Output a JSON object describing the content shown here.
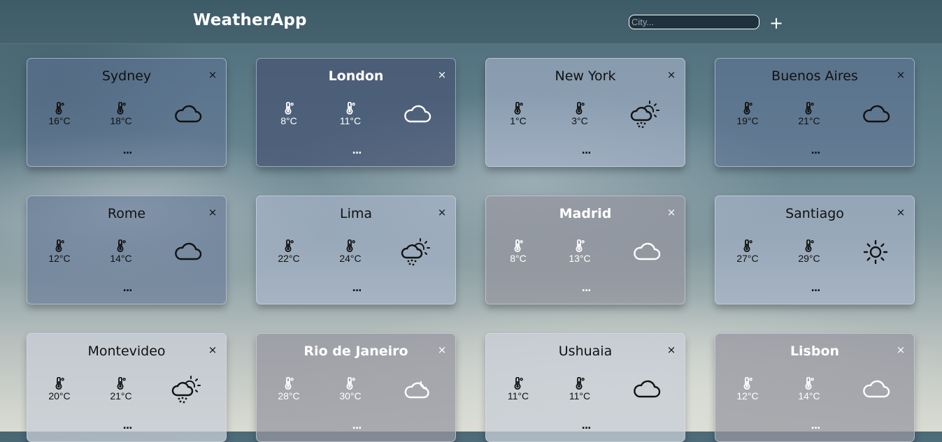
{
  "app": {
    "brand": "WeatherApp",
    "search_placeholder": "City...",
    "add_label": "+"
  },
  "cards": [
    {
      "city": "Sydney",
      "min": "16°C",
      "max": "18°C",
      "icon": "cloud-icon",
      "style": "normal",
      "close": "×",
      "more": "..."
    },
    {
      "city": "London",
      "min": "8°C",
      "max": "11°C",
      "icon": "cloud-icon",
      "style": "dark",
      "close": "×",
      "more": "..."
    },
    {
      "city": "New York",
      "min": "1°C",
      "max": "3°C",
      "icon": "sun-cloud-rain-icon",
      "style": "light",
      "close": "×",
      "more": "..."
    },
    {
      "city": "Buenos Aires",
      "min": "19°C",
      "max": "21°C",
      "icon": "cloud-icon",
      "style": "normal",
      "close": "×",
      "more": "..."
    },
    {
      "city": "Rome",
      "min": "12°C",
      "max": "14°C",
      "icon": "cloud-icon",
      "style": "normal",
      "close": "×",
      "more": "..."
    },
    {
      "city": "Lima",
      "min": "22°C",
      "max": "24°C",
      "icon": "sun-cloud-rain-icon",
      "style": "light",
      "close": "×",
      "more": "..."
    },
    {
      "city": "Madrid",
      "min": "8°C",
      "max": "13°C",
      "icon": "cloud-icon",
      "style": "gray",
      "close": "×",
      "more": "..."
    },
    {
      "city": "Santiago",
      "min": "27°C",
      "max": "29°C",
      "icon": "sun-icon",
      "style": "light",
      "close": "×",
      "more": "..."
    },
    {
      "city": "Montevideo",
      "min": "20°C",
      "max": "21°C",
      "icon": "sun-cloud-rain-icon",
      "style": "pale",
      "close": "×",
      "more": "..."
    },
    {
      "city": "Rio de Janeiro",
      "min": "28°C",
      "max": "30°C",
      "icon": "moon-cloud-icon",
      "style": "gray",
      "close": "×",
      "more": "..."
    },
    {
      "city": "Ushuaia",
      "min": "11°C",
      "max": "11°C",
      "icon": "cloud-icon",
      "style": "pale",
      "close": "×",
      "more": "..."
    },
    {
      "city": "Lisbon",
      "min": "12°C",
      "max": "14°C",
      "icon": "cloud-icon",
      "style": "gray",
      "close": "×",
      "more": "..."
    }
  ]
}
